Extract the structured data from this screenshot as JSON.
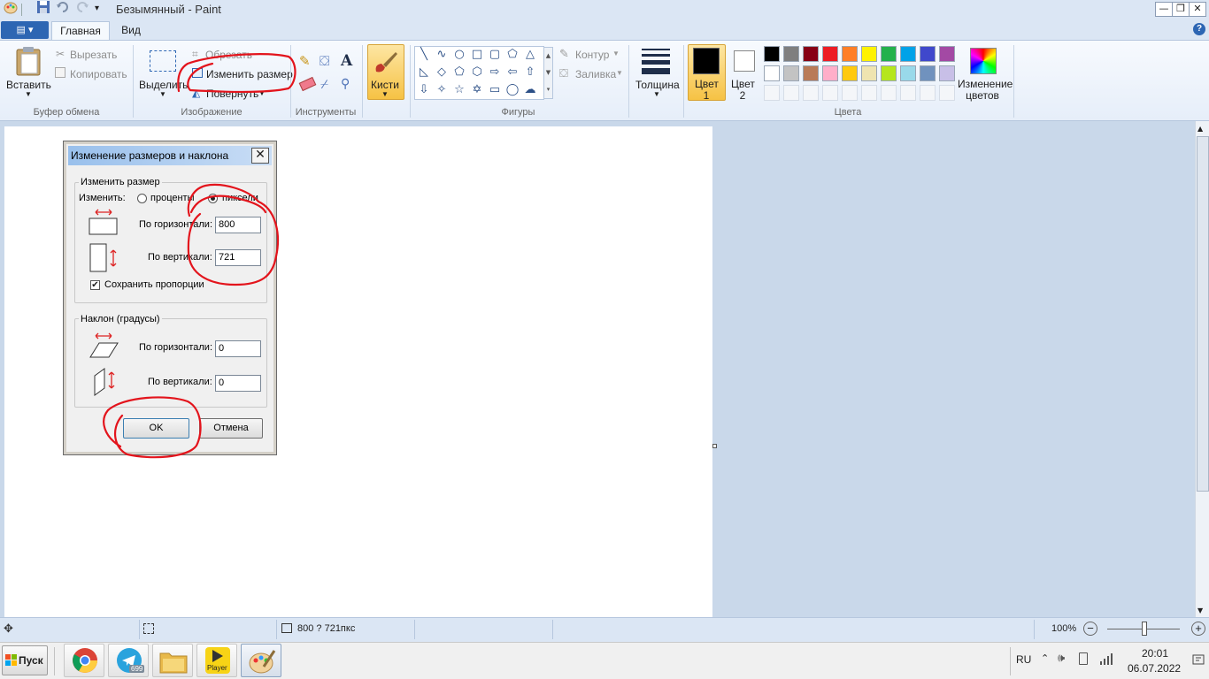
{
  "window": {
    "title": "Безымянный - Paint",
    "minimize": "—",
    "restore": "❐",
    "close": "✕"
  },
  "tabs": {
    "file": "▤ ▾",
    "home": "Главная",
    "view": "Вид",
    "help": "?"
  },
  "ribbon": {
    "clipboard": {
      "paste": "Вставить",
      "cut": "Вырезать",
      "copy": "Копировать",
      "group": "Буфер обмена"
    },
    "image": {
      "select": "Выделить",
      "crop": "Обрезать",
      "resize": "Изменить размер",
      "rotate": "Повернуть",
      "group": "Изображение"
    },
    "tools": {
      "group": "Инструменты"
    },
    "brushes": {
      "label": "Кисти"
    },
    "shapes": {
      "outline": "Контур",
      "fill": "Заливка",
      "group": "Фигуры"
    },
    "size": {
      "label": "Толщина"
    },
    "colors": {
      "color1": "Цвет 1",
      "color2": "Цвет 2",
      "edit": "Изменение цветов",
      "group": "Цвета",
      "color1_value": "#000000",
      "color2_value": "#ffffff",
      "palette_row1": [
        "#000000",
        "#7f7f7f",
        "#880015",
        "#ed1c24",
        "#ff7f27",
        "#fff200",
        "#22b14c",
        "#00a2e8",
        "#3f48cc",
        "#a349a4"
      ],
      "palette_row2": [
        "#ffffff",
        "#c3c3c3",
        "#b97a57",
        "#ffaec9",
        "#ffc90e",
        "#efe4b0",
        "#b5e61d",
        "#99d9ea",
        "#7092be",
        "#c8bfe7"
      ]
    }
  },
  "dialog": {
    "title": "Изменение размеров и наклона",
    "close": "✕",
    "resize": {
      "legend": "Изменить размер",
      "by_label": "Изменить:",
      "percent": "проценты",
      "pixels": "пиксели",
      "mode": "pixels",
      "horizontal_label": "По горизонтали:",
      "vertical_label": "По вертикали:",
      "horizontal": "800",
      "vertical": "721",
      "keep_ratio_label": "Сохранить пропорции",
      "keep_ratio": true
    },
    "skew": {
      "legend": "Наклон (градусы)",
      "horizontal_label": "По горизонтали:",
      "vertical_label": "По вертикали:",
      "horizontal": "0",
      "vertical": "0"
    },
    "ok": "OK",
    "cancel": "Отмена"
  },
  "statusbar": {
    "size": "800 ? 721пкс",
    "zoom": "100%",
    "zoom_out": "−",
    "zoom_in": "+"
  },
  "taskbar": {
    "start": "Пуск",
    "telegram_badge": "699",
    "player_label": "Player",
    "lang": "RU",
    "time": "20:01",
    "date": "06.07.2022"
  }
}
